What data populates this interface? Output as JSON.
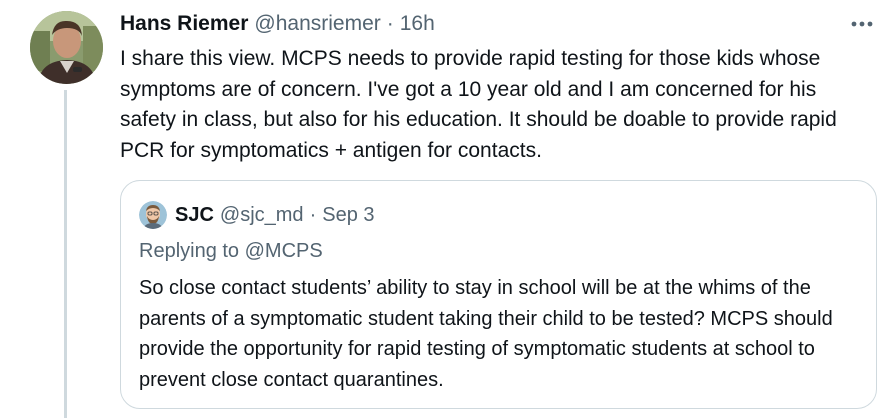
{
  "tweet": {
    "display_name": "Hans Riemer",
    "handle": "@hansriemer",
    "separator": "·",
    "time": "16h",
    "text": "I share this view. MCPS needs to provide rapid testing for those kids whose symptoms are of concern. I've got a 10 year old and I am concerned for his safety in class, but also for his education. It should be doable to provide rapid PCR for symptomatics + antigen for contacts."
  },
  "quoted_tweet": {
    "display_name": "SJC",
    "handle": "@sjc_md",
    "separator": "·",
    "time": "Sep 3",
    "replying_to": "Replying to @MCPS",
    "text": "So close contact students’ ability to stay in school will be at the whims of the parents of a symptomatic student taking their child to be tested? MCPS should provide the opportunity for rapid testing of symptomatic students at school to prevent close contact quarantines."
  },
  "icons": {
    "more": "more-horizontal-icon"
  },
  "colors": {
    "text_primary": "#0f1419",
    "text_secondary": "#536471",
    "border": "#cfd9de"
  }
}
